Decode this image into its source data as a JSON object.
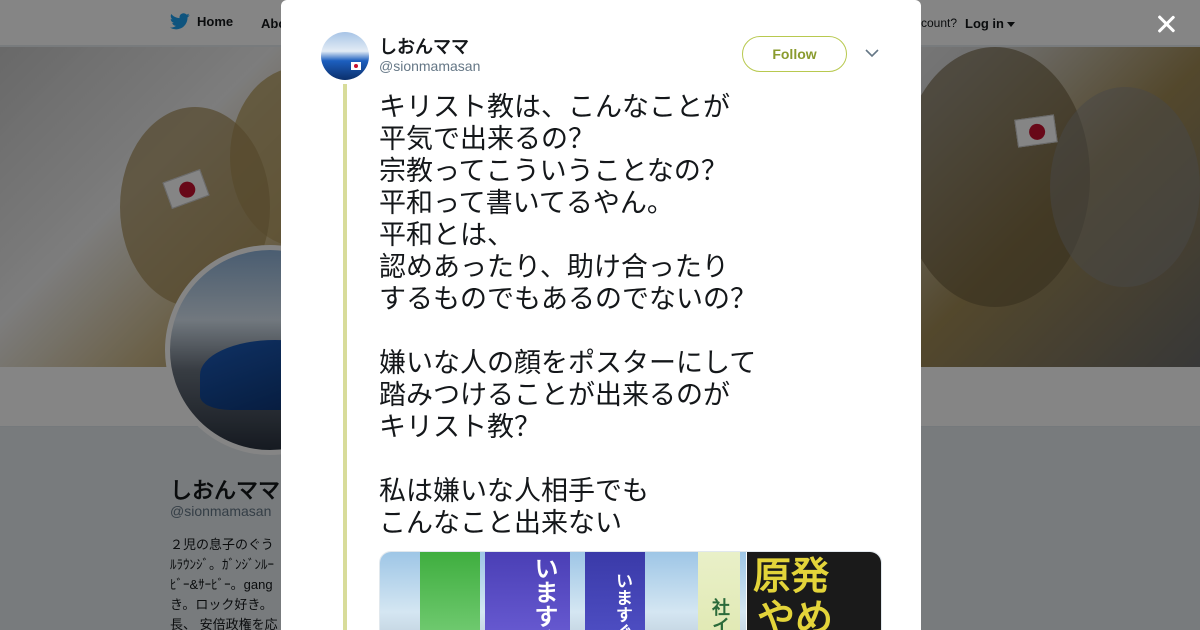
{
  "topbar": {
    "home_label": "Home",
    "about_label": "Abo",
    "account_prompt": "ccount?",
    "login_label": "Log in"
  },
  "profile": {
    "name": "しおんママ",
    "handle": "@sionmamasan",
    "bio_lines": [
      "２児の息子のぐう",
      "ﾙﾗｳﾝｼﾞ。ｶﾞﾝｼﾞﾝﾙｰ",
      "ﾋﾞｰ&ｻｰﾋﾞｰ。gang",
      "き。ロック好き。",
      "長、 安倍政権を応"
    ]
  },
  "tweet": {
    "author_name": "しおんママ",
    "author_handle": "@sionmamasan",
    "follow_label": "Follow",
    "text": "キリスト教は、こんなことが\n平気で出来るの？\n宗教ってこういうことなの？\n平和って書いてるやん。\n平和とは、\n認めあったり、助け合ったり\nするものでもあるのでないの？\n\n嫌いな人の顔をポスターにして\n踏みつけることが出来るのが\nキリスト教？\n\n私は嫌いな人相手でも\nこんなこと出来ない",
    "media": {
      "banner_texts": [
        "いますぐ",
        "いますぐ",
        "社イ"
      ],
      "sign_text_line1": "原発",
      "sign_text_line2": "やめ"
    }
  },
  "colors": {
    "twitter_blue": "#1da1f2",
    "follow_accent": "#8a9b2e",
    "thread_line": "#d8dc9a",
    "overlay": "rgba(0,0,0,0.48)"
  },
  "icons": {
    "home": "twitter-bird-icon",
    "close": "close-icon",
    "more": "chevron-down-icon"
  }
}
